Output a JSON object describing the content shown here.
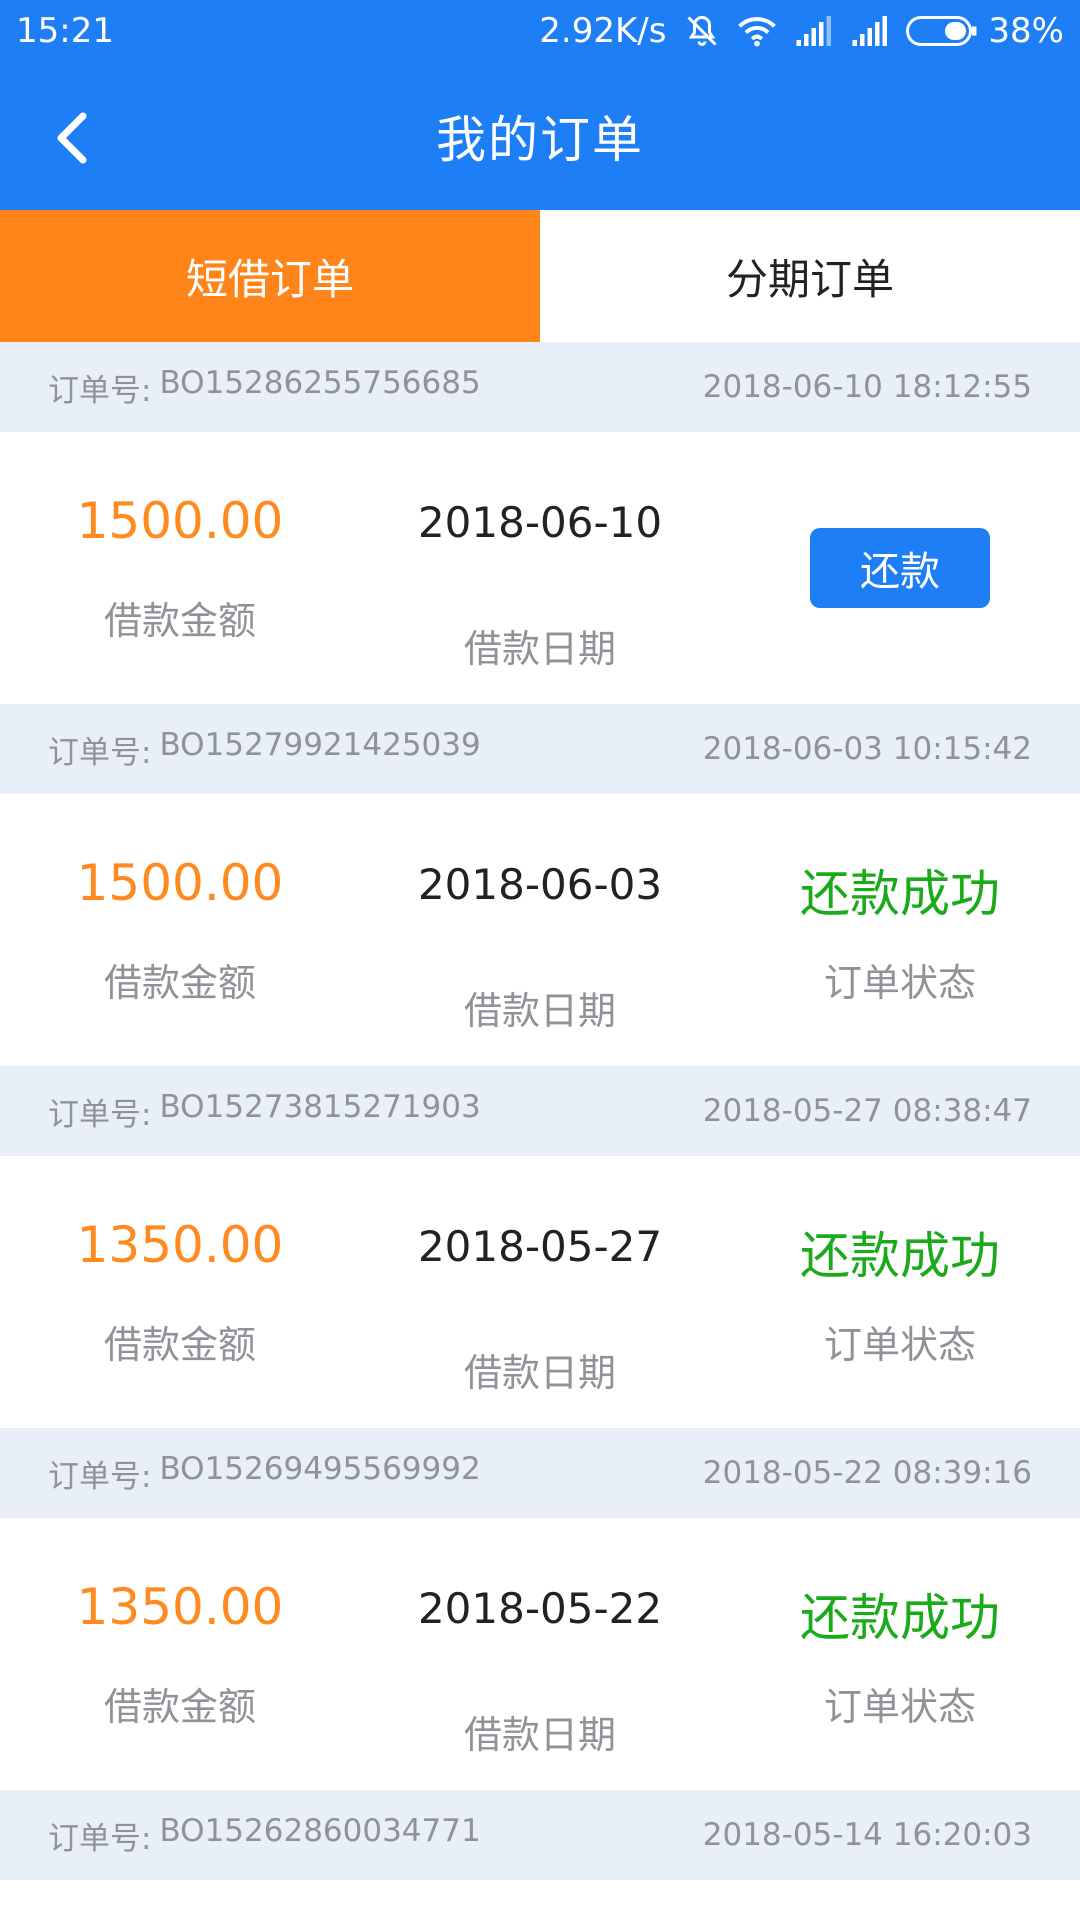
{
  "status_bar": {
    "time": "15:21",
    "network_speed": "2.92K/s",
    "battery": "38%",
    "icons": [
      "mute-icon",
      "wifi-icon",
      "signal-icon",
      "signal-icon",
      "battery-icon"
    ]
  },
  "header": {
    "title": "我的订单",
    "back_icon": "chevron-left-icon"
  },
  "tabs": [
    {
      "label": "短借订单",
      "active": true
    },
    {
      "label": "分期订单",
      "active": false
    }
  ],
  "labels": {
    "order_no_prefix": "订单号:",
    "amount_label": "借款金额",
    "date_label": "借款日期",
    "status_label": "订单状态"
  },
  "orders": [
    {
      "order_no": "BO15286255756685",
      "datetime": "2018-06-10 18:12:55",
      "amount": "1500.00",
      "date": "2018-06-10",
      "action_label": "还款",
      "status": ""
    },
    {
      "order_no": "BO15279921425039",
      "datetime": "2018-06-03 10:15:42",
      "amount": "1500.00",
      "date": "2018-06-03",
      "status": "还款成功"
    },
    {
      "order_no": "BO15273815271903",
      "datetime": "2018-05-27 08:38:47",
      "amount": "1350.00",
      "date": "2018-05-27",
      "status": "还款成功"
    },
    {
      "order_no": "BO15269495569992",
      "datetime": "2018-05-22 08:39:16",
      "amount": "1350.00",
      "date": "2018-05-22",
      "status": "还款成功"
    },
    {
      "order_no": "BO15262860034771",
      "datetime": "2018-05-14 16:20:03"
    }
  ],
  "colors": {
    "primary": "#1e7ef5",
    "accent": "#ff841a",
    "success": "#1aaa1a",
    "section_bg": "#e8eff8"
  }
}
